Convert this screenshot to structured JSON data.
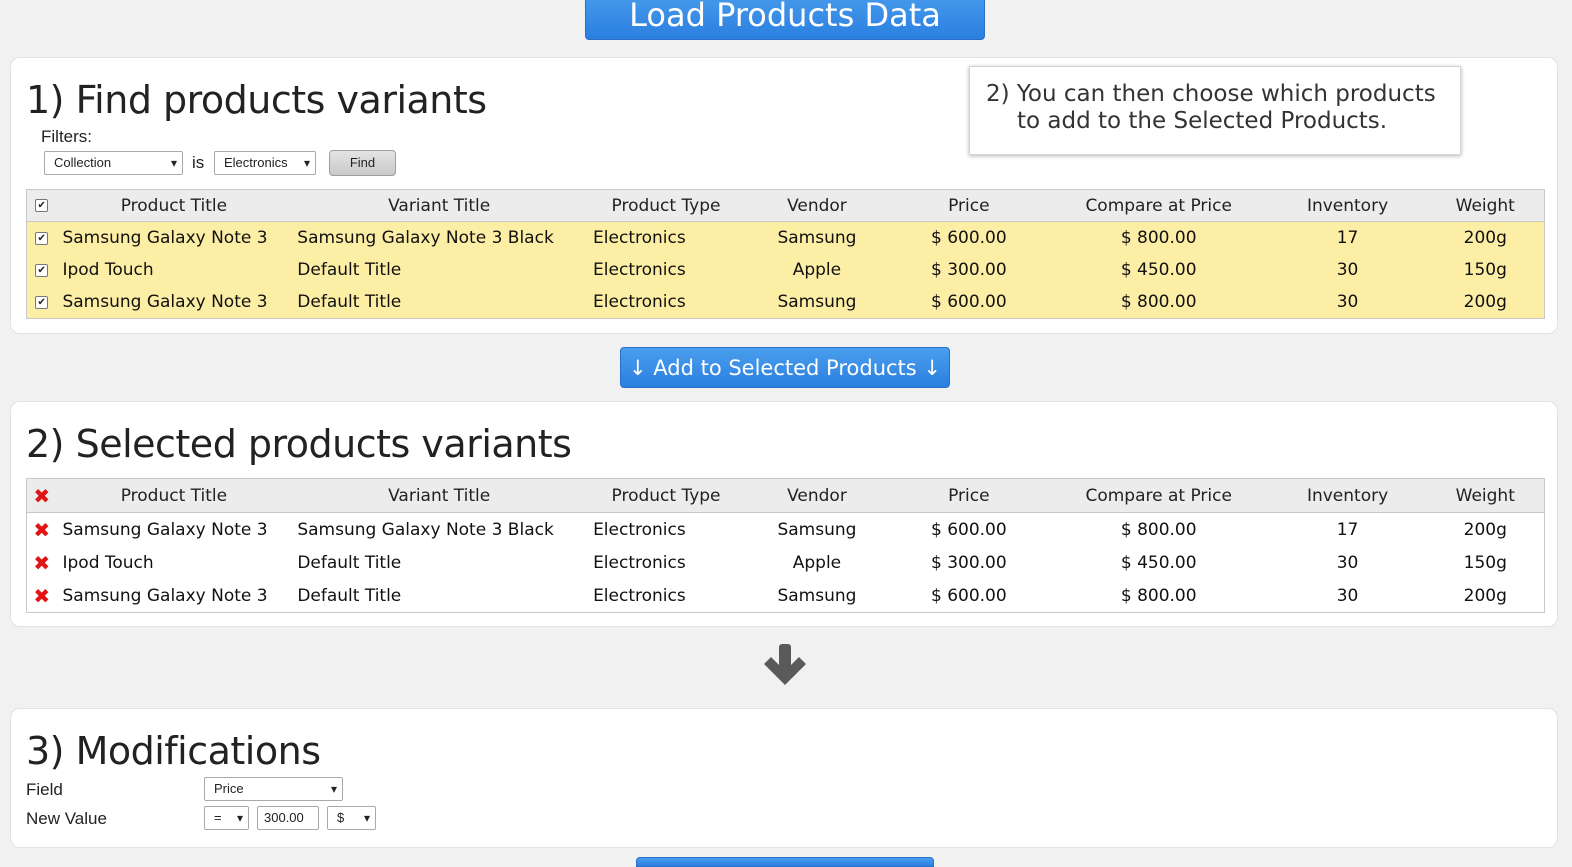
{
  "load_button": "Load Products Data",
  "find_section": {
    "title": "1) Find products variants",
    "filters_label": "Filters:",
    "filter_field": "Collection",
    "filter_operator": "is",
    "filter_value": "Electronics",
    "find_label": "Find",
    "callout_line1": "2) You can then choose which products",
    "callout_line2": "to add to the Selected Products.",
    "columns": [
      "Product Title",
      "Variant Title",
      "Product Type",
      "Vendor",
      "Price",
      "Compare at Price",
      "Inventory",
      "Weight"
    ],
    "rows": [
      [
        "Samsung Galaxy Note 3",
        "Samsung Galaxy Note 3 Black",
        "Electronics",
        "Samsung",
        "$ 600.00",
        "$ 800.00",
        "17",
        "200g"
      ],
      [
        "Ipod Touch",
        "Default Title",
        "Electronics",
        "Apple",
        "$ 300.00",
        "$ 450.00",
        "30",
        "150g"
      ],
      [
        "Samsung Galaxy Note 3",
        "Default Title",
        "Electronics",
        "Samsung",
        "$ 600.00",
        "$ 800.00",
        "30",
        "200g"
      ]
    ]
  },
  "add_button": "↓  Add to Selected Products  ↓",
  "selected_section": {
    "title": "2) Selected products variants",
    "columns": [
      "Product Title",
      "Variant Title",
      "Product Type",
      "Vendor",
      "Price",
      "Compare at Price",
      "Inventory",
      "Weight"
    ],
    "rows": [
      [
        "Samsung Galaxy Note 3",
        "Samsung Galaxy Note 3 Black",
        "Electronics",
        "Samsung",
        "$ 600.00",
        "$ 800.00",
        "17",
        "200g"
      ],
      [
        "Ipod Touch",
        "Default Title",
        "Electronics",
        "Apple",
        "$ 300.00",
        "$ 450.00",
        "30",
        "150g"
      ],
      [
        "Samsung Galaxy Note 3",
        "Default Title",
        "Electronics",
        "Samsung",
        "$ 600.00",
        "$ 800.00",
        "30",
        "200g"
      ]
    ]
  },
  "modifications": {
    "title": "3) Modifications",
    "field_label": "Field",
    "field_value": "Price",
    "new_value_label": "New Value",
    "operator": "=",
    "value": "300.00",
    "unit": "$"
  },
  "colors": {
    "accent": "#2b7fe0",
    "row_highlight": "#fdeea5",
    "remove": "#e01414"
  },
  "icons": {
    "remove": "close-icon",
    "arrow": "arrow-down-icon"
  }
}
